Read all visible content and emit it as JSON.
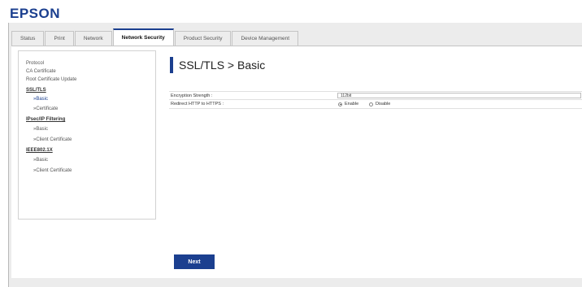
{
  "header": {
    "logo": "EPSON"
  },
  "tabs": [
    {
      "label": "Status"
    },
    {
      "label": "Print"
    },
    {
      "label": "Network"
    },
    {
      "label": "Network Security"
    },
    {
      "label": "Product Security"
    },
    {
      "label": "Device Management"
    }
  ],
  "active_tab": "Network Security",
  "sidebar": {
    "items": [
      {
        "label": "Protocol"
      },
      {
        "label": "CA Certificate"
      },
      {
        "label": "Root Certificate Update"
      },
      {
        "label": "SSL/TLS"
      },
      {
        "label": "»Basic"
      },
      {
        "label": "»Certificate"
      },
      {
        "label": "IPsec/IP Filtering"
      },
      {
        "label": "»Basic"
      },
      {
        "label": "»Client Certificate"
      },
      {
        "label": "IEEE802.1X"
      },
      {
        "label": "»Basic"
      },
      {
        "label": "»Client Certificate"
      }
    ]
  },
  "main": {
    "title": "SSL/TLS > Basic",
    "encryption_strength": {
      "label": "Encryption Strength :",
      "value": "112bit"
    },
    "redirect": {
      "label": "Redirect HTTP to HTTPS :",
      "options": [
        {
          "label": "Enable",
          "selected": true
        },
        {
          "label": "Disable",
          "selected": false
        }
      ]
    },
    "next_label": "Next"
  },
  "colors": {
    "accent": "#1b3f8f",
    "frame": "#ececec"
  }
}
